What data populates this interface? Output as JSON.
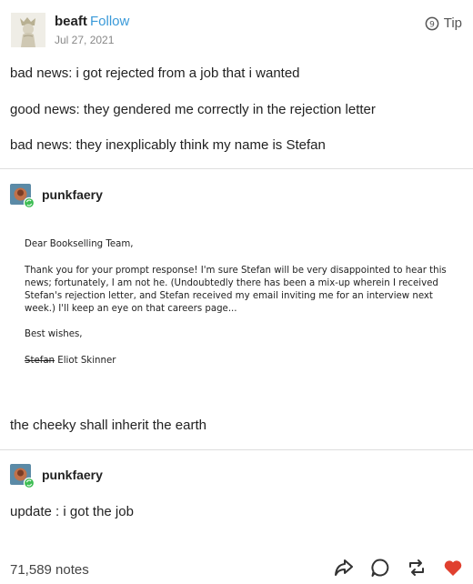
{
  "post": {
    "author": "beaft",
    "follow_label": "Follow",
    "date": "Jul 27, 2021",
    "tip_label": "Tip",
    "paragraphs": [
      "bad news: i got rejected from a job that i wanted",
      "good news: they gendered me correctly in the rejection letter",
      "bad news: they inexplicably think my name is Stefan"
    ]
  },
  "reblog1": {
    "author": "punkfaery",
    "letter": {
      "greeting": "Dear Bookselling Team,",
      "body_lines": [
        "Thank you for your prompt response! I'm sure Stefan will be very disappointed to hear this",
        "news; fortunately, I am not he. (Undoubtedly there has been a mix-up wherein I received",
        "Stefan's rejection letter, and Stefan received my email inviting me for an interview next",
        "week.) I'll keep an eye on that careers page..."
      ],
      "closing": "Best wishes,",
      "signature_struck": "Stefan",
      "signature_name": "Eliot Skinner"
    },
    "comment": "the cheeky shall inherit the earth"
  },
  "reblog2": {
    "author": "punkfaery",
    "comment": "update : i got the job"
  },
  "footer": {
    "notes": "71,589 notes"
  },
  "colors": {
    "follow": "#3a9ad9",
    "like": "#e0402f",
    "badge": "#3cbd52"
  }
}
